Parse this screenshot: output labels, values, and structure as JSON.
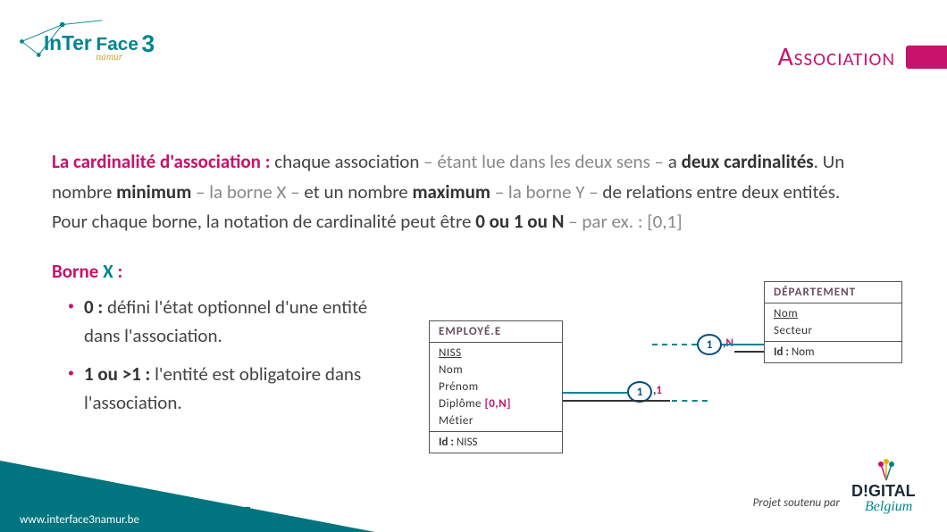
{
  "header": {
    "logo_text": "InTerFace",
    "logo_number": "3",
    "logo_sub": "namur",
    "title": "Association"
  },
  "para": {
    "p1_lead": "La cardinalité d'association : ",
    "p1_a": "chaque association ",
    "p1_b": "– étant lue dans les deux sens – ",
    "p1_c": "a ",
    "p1_d": "deux cardinalités",
    "p1_e": ". Un nombre ",
    "p1_f": "minimum",
    "p1_g": " – la borne X – ",
    "p1_h": "et un nombre ",
    "p1_i": "maximum",
    "p1_j": " – la borne Y – ",
    "p1_k": "de relations entre deux entités. Pour chaque borne, la notation de cardinalité peut être ",
    "p1_l": "0 ou 1 ou N",
    "p1_m": " – par ex. : [0,1]"
  },
  "borne": {
    "head_a": "Borne ",
    "head_b": "X",
    "head_c": " :",
    "li1_a": "0 : ",
    "li1_b": "défini l'état optionnel d'une entité dans l'association.",
    "li2_a": "1 ou >1 : ",
    "li2_b": "l'entité est obligatoire dans l'association."
  },
  "diagram": {
    "employee": {
      "title": "EMPLOYÉ.E",
      "attrs": [
        "NISS",
        "Nom",
        "Prénom",
        "Diplôme",
        "Métier"
      ],
      "diplome_card": "[0,N]",
      "id_label": "Id : ",
      "id_value": "NISS"
    },
    "department": {
      "title": "DÉPARTEMENT",
      "attrs": [
        "Nom",
        "Secteur"
      ],
      "id_label": "Id : ",
      "id_value": "Nom"
    },
    "card1_inner": "1",
    "card1_comma": ",",
    "card1_after": "1",
    "card2_inner": "1",
    "card2_comma": ",",
    "card2_after": "N"
  },
  "footer": {
    "url": "www.interface3namur.be",
    "projet": "Projet soutenu par",
    "digital_a": "D!GITAL",
    "digital_b": "Belgium"
  }
}
